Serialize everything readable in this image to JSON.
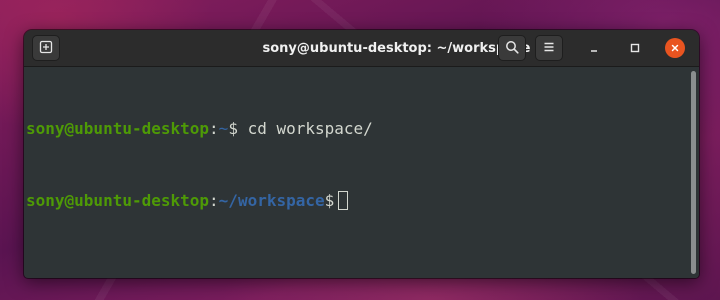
{
  "window": {
    "title": "sony@ubuntu-desktop: ~/workspace"
  },
  "titlebar": {
    "new_tab_icon": "new-tab-icon",
    "search_icon": "search-icon",
    "menu_icon": "hamburger-menu-icon",
    "minimize_icon": "minimize-icon",
    "maximize_icon": "maximize-icon",
    "close_icon": "close-icon"
  },
  "terminal": {
    "lines": [
      {
        "user_host": "sony@ubuntu-desktop",
        "colon": ":",
        "path": "~",
        "prompt": "$",
        "command": " cd workspace/"
      },
      {
        "user_host": "sony@ubuntu-desktop",
        "colon": ":",
        "path": "~/workspace",
        "prompt": "$",
        "command": " "
      }
    ]
  },
  "colors": {
    "accent_close": "#e95420",
    "user_host": "#4e9a06",
    "path": "#3465a4",
    "terminal_bg": "#2e3436",
    "terminal_fg": "#d3d7cf"
  }
}
